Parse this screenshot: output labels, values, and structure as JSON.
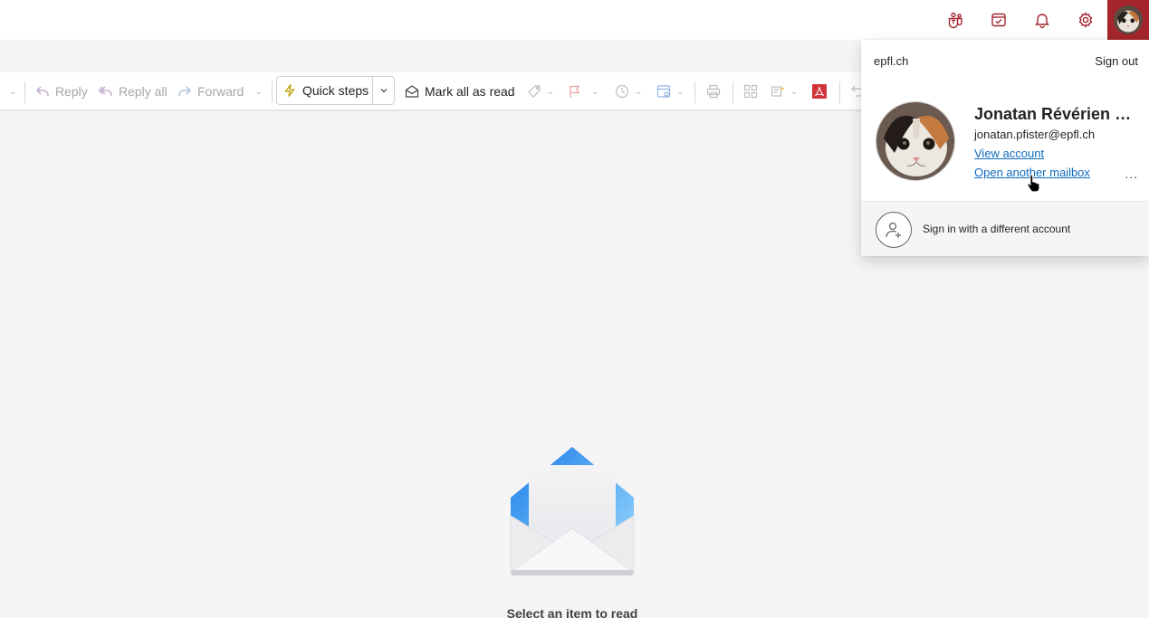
{
  "header": {
    "icons": [
      "teams-icon",
      "todo-icon",
      "bell-icon",
      "gear-icon"
    ],
    "brand_color": "#a4262c"
  },
  "ribbon": {
    "reply_label": "Reply",
    "reply_all_label": "Reply all",
    "forward_label": "Forward",
    "quick_steps_label": "Quick steps",
    "mark_all_read_label": "Mark all as read"
  },
  "reading_pane": {
    "empty_message": "Select an item to read"
  },
  "account_popup": {
    "org": "epfl.ch",
    "sign_out_label": "Sign out",
    "user_name": "Jonatan Révérien Pfister",
    "user_email": "jonatan.pfister@epfl.ch",
    "view_account_label": "View account",
    "open_mailbox_label": "Open another mailbox",
    "more_label": "...",
    "other_account_label": "Sign in with a different account"
  },
  "colors": {
    "accent": "#0f6cbd",
    "icon_red": "#c4314b",
    "flag": "#d13438",
    "text": "#242424"
  }
}
